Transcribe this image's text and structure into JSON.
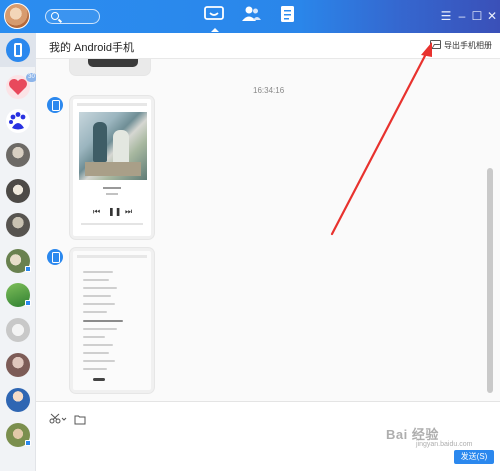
{
  "header": {
    "title": "我的 Android手机",
    "export_label": "导出手机相册"
  },
  "chat": {
    "timestamp": "16:34:16",
    "player_controls": [
      "⏮",
      "❚❚",
      "⏭"
    ]
  },
  "sidebar": {
    "items": [
      {
        "name": "my-android-phone",
        "icon": "phone-icon",
        "selected": true
      },
      {
        "name": "heart-contact",
        "icon": "heart-icon",
        "badge": "30"
      },
      {
        "name": "baidu-contact",
        "icon": "baidu-paw-icon"
      },
      {
        "name": "contact-4",
        "icon": "avatar"
      },
      {
        "name": "contact-5",
        "icon": "avatar"
      },
      {
        "name": "contact-6",
        "icon": "avatar"
      },
      {
        "name": "contact-7",
        "icon": "avatar"
      },
      {
        "name": "contact-8",
        "icon": "avatar"
      },
      {
        "name": "contact-9",
        "icon": "avatar"
      },
      {
        "name": "contact-10",
        "icon": "avatar"
      },
      {
        "name": "contact-11",
        "icon": "avatar"
      },
      {
        "name": "contact-12",
        "icon": "avatar"
      }
    ]
  },
  "input": {
    "send_label": "发送(S)"
  },
  "watermark": {
    "text": "Bai 经验",
    "sub": "jingyan.baidu.com"
  },
  "colors": {
    "topbar_blue": "#2b8df0",
    "accent_blue": "#2b88ee",
    "arrow_red": "#e8322e"
  }
}
